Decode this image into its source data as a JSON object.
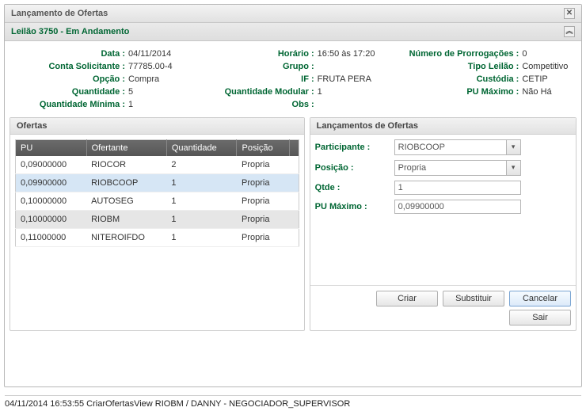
{
  "window": {
    "title": "Lançamento de Ofertas"
  },
  "subheader": {
    "text": "Leilão 3750 - Em Andamento"
  },
  "details": {
    "col1": {
      "data_lbl": "Data :",
      "data_val": "04/11/2014",
      "conta_lbl": "Conta Solicitante :",
      "conta_val": "77785.00-4",
      "opcao_lbl": "Opção :",
      "opcao_val": "Compra",
      "qtd_lbl": "Quantidade :",
      "qtd_val": "5",
      "qtdmin_lbl": "Quantidade Mínima :",
      "qtdmin_val": "1"
    },
    "col2": {
      "horario_lbl": "Horário :",
      "horario_val": "16:50 às 17:20",
      "grupo_lbl": "Grupo :",
      "grupo_val": "",
      "if_lbl": "IF :",
      "if_val": "FRUTA PERA",
      "qtdmod_lbl": "Quantidade Modular :",
      "qtdmod_val": "1",
      "obs_lbl": "Obs :",
      "obs_val": ""
    },
    "col3": {
      "prorr_lbl": "Número de Prorrogações :",
      "prorr_val": "0",
      "tipo_lbl": "Tipo Leilão :",
      "tipo_val": "Competitivo",
      "custodia_lbl": "Custódia :",
      "custodia_val": "CETIP",
      "pumax_lbl": "PU Máximo :",
      "pumax_val": "Não Há"
    }
  },
  "ofertas": {
    "header": "Ofertas",
    "cols": {
      "pu": "PU",
      "ofertante": "Ofertante",
      "qtd": "Quantidade",
      "pos": "Posição"
    },
    "rows": [
      {
        "pu": "0,09000000",
        "ofertante": "RIOCOR",
        "qtd": "2",
        "pos": "Propria"
      },
      {
        "pu": "0,09900000",
        "ofertante": "RIOBCOOP",
        "qtd": "1",
        "pos": "Propria"
      },
      {
        "pu": "0,10000000",
        "ofertante": "AUTOSEG",
        "qtd": "1",
        "pos": "Propria"
      },
      {
        "pu": "0,10000000",
        "ofertante": "RIOBM",
        "qtd": "1",
        "pos": "Propria"
      },
      {
        "pu": "0,11000000",
        "ofertante": "NITEROIFDO",
        "qtd": "1",
        "pos": "Propria"
      }
    ]
  },
  "lancamentos": {
    "header": "Lançamentos de Ofertas",
    "participante_lbl": "Participante :",
    "participante_val": "RIOBCOOP",
    "posicao_lbl": "Posição :",
    "posicao_val": "Propria",
    "qtde_lbl": "Qtde :",
    "qtde_val": "1",
    "pumax_lbl": "PU Máximo :",
    "pumax_val": "0,09900000"
  },
  "buttons": {
    "criar": "Criar",
    "substituir": "Substituir",
    "cancelar": "Cancelar",
    "sair": "Sair"
  },
  "status": "04/11/2014 16:53:55 CriarOfertasView RIOBM / DANNY - NEGOCIADOR_SUPERVISOR"
}
